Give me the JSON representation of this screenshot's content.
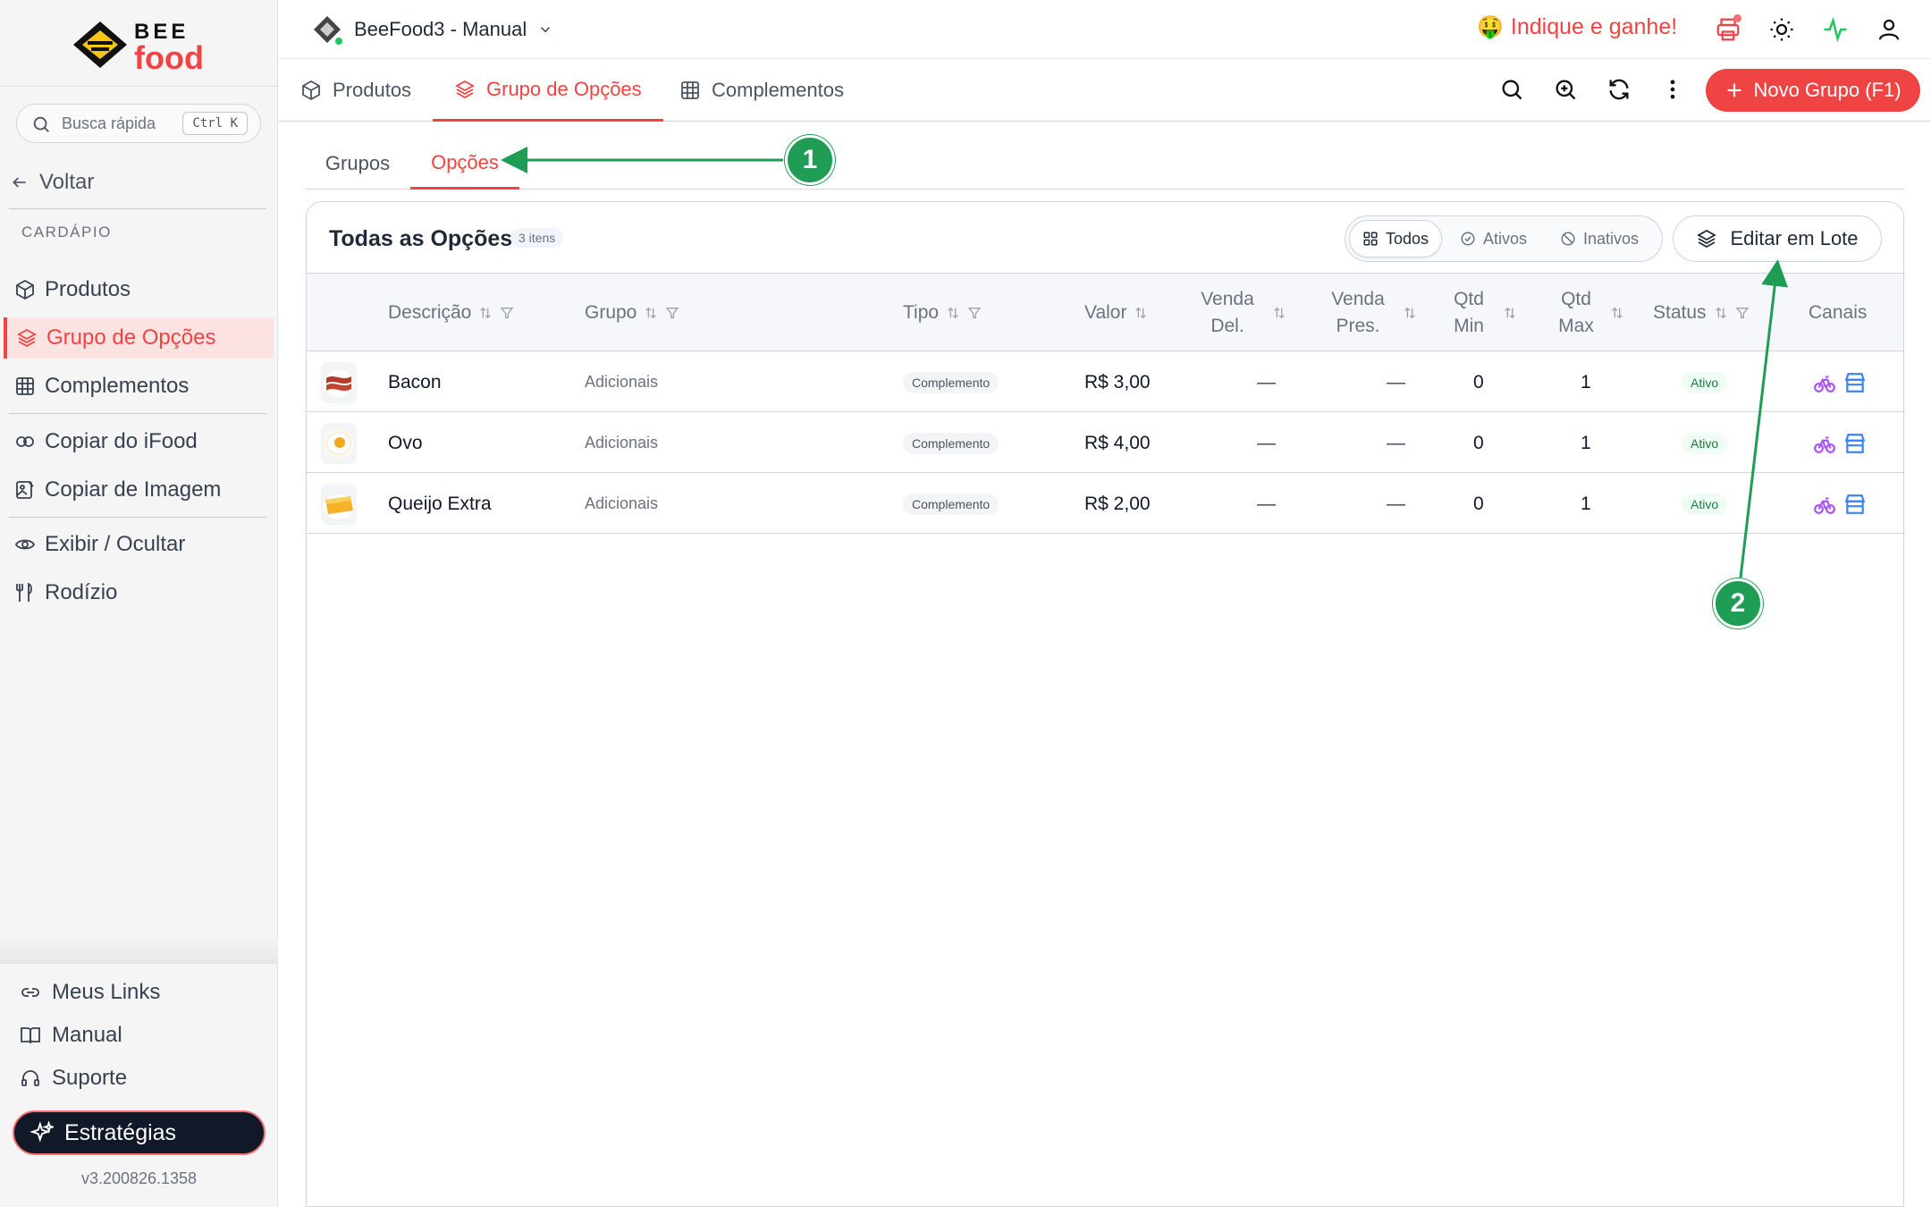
{
  "brand": {
    "line1": "BEE",
    "line2": "food"
  },
  "sidebar": {
    "search_label": "Busca rápida",
    "search_shortcut": "Ctrl K",
    "back_label": "Voltar",
    "section_title": "CARDÁPIO",
    "items": [
      {
        "label": "Produtos",
        "icon": "box-icon"
      },
      {
        "label": "Grupo de Opções",
        "icon": "layers-icon",
        "active": true
      },
      {
        "label": "Complementos",
        "icon": "grid-icon"
      },
      {
        "label": "Copiar do iFood",
        "icon": "copy-link-icon"
      },
      {
        "label": "Copiar de Imagem",
        "icon": "image-edit-icon"
      },
      {
        "label": "Exibir / Ocultar",
        "icon": "eye-icon"
      },
      {
        "label": "Rodízio",
        "icon": "utensils-icon"
      }
    ],
    "footer_links": [
      {
        "label": "Meus Links",
        "icon": "link-icon"
      },
      {
        "label": "Manual",
        "icon": "book-icon"
      },
      {
        "label": "Suporte",
        "icon": "headset-icon"
      }
    ],
    "strategies_label": "Estratégias",
    "version": "v3.200826.1358"
  },
  "topbar": {
    "store_name": "BeeFood3 - Manual",
    "invite_label": "Indique e ganhe!",
    "invite_emoji": "🤑"
  },
  "tabs": {
    "items": [
      {
        "label": "Produtos",
        "icon": "box-icon"
      },
      {
        "label": "Grupo de Opções",
        "icon": "layers-icon",
        "active": true
      },
      {
        "label": "Complementos",
        "icon": "grid-icon"
      }
    ],
    "new_button": "Novo Grupo (F1)"
  },
  "subtabs": {
    "items": [
      {
        "label": "Grupos"
      },
      {
        "label": "Opções",
        "active": true
      }
    ]
  },
  "card": {
    "title": "Todas as Opções",
    "count": "3 itens",
    "filters": [
      {
        "label": "Todos",
        "active": true
      },
      {
        "label": "Ativos"
      },
      {
        "label": "Inativos"
      }
    ],
    "batch_edit": "Editar em Lote"
  },
  "table": {
    "headers": {
      "descricao": "Descrição",
      "grupo": "Grupo",
      "tipo": "Tipo",
      "valor": "Valor",
      "venda_del": [
        "Venda",
        "Del."
      ],
      "venda_pres": [
        "Venda",
        "Pres."
      ],
      "qtd_min": [
        "Qtd",
        "Min"
      ],
      "qtd_max": [
        "Qtd",
        "Max"
      ],
      "status": "Status",
      "canais": "Canais"
    },
    "rows": [
      {
        "desc": "Bacon",
        "grupo": "Adicionais",
        "tipo": "Complemento",
        "valor": "R$ 3,00",
        "venda_del": "—",
        "venda_pres": "—",
        "qtd_min": "0",
        "qtd_max": "1",
        "status": "Ativo"
      },
      {
        "desc": "Ovo",
        "grupo": "Adicionais",
        "tipo": "Complemento",
        "valor": "R$ 4,00",
        "venda_del": "—",
        "venda_pres": "—",
        "qtd_min": "0",
        "qtd_max": "1",
        "status": "Ativo"
      },
      {
        "desc": "Queijo Extra",
        "grupo": "Adicionais",
        "tipo": "Complemento",
        "valor": "R$ 2,00",
        "venda_del": "—",
        "venda_pres": "—",
        "qtd_min": "0",
        "qtd_max": "1",
        "status": "Ativo"
      }
    ]
  },
  "annotations": [
    {
      "label": "1"
    },
    {
      "label": "2"
    }
  ],
  "colors": {
    "accent": "#ef4444",
    "annotation": "#1f9d55",
    "status_ok": "#15803d"
  }
}
